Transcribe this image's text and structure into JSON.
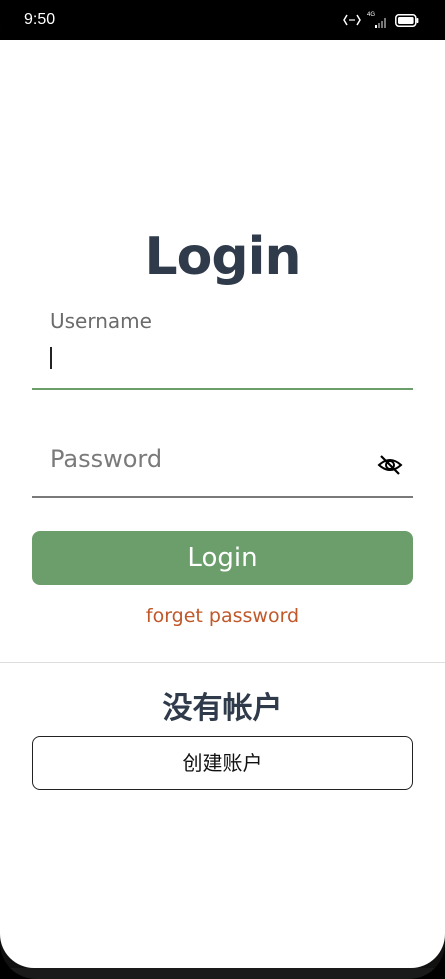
{
  "status_bar": {
    "time": "9:50",
    "icons": [
      "nfc-icon",
      "signal-4g-icon",
      "battery-icon"
    ],
    "network_label": "4G"
  },
  "login": {
    "title": "Login",
    "username_label": "Username",
    "username_value": "",
    "password_placeholder": "Password",
    "password_toggle_icon": "eye-off-icon",
    "login_button_label": "Login",
    "forget_password_label": "forget password"
  },
  "signup": {
    "prompt": "没有帐户",
    "create_account_label": "创建账户"
  },
  "colors": {
    "accent": "#6b9e6b",
    "title": "#2f3a4a",
    "link": "#c0582a"
  }
}
